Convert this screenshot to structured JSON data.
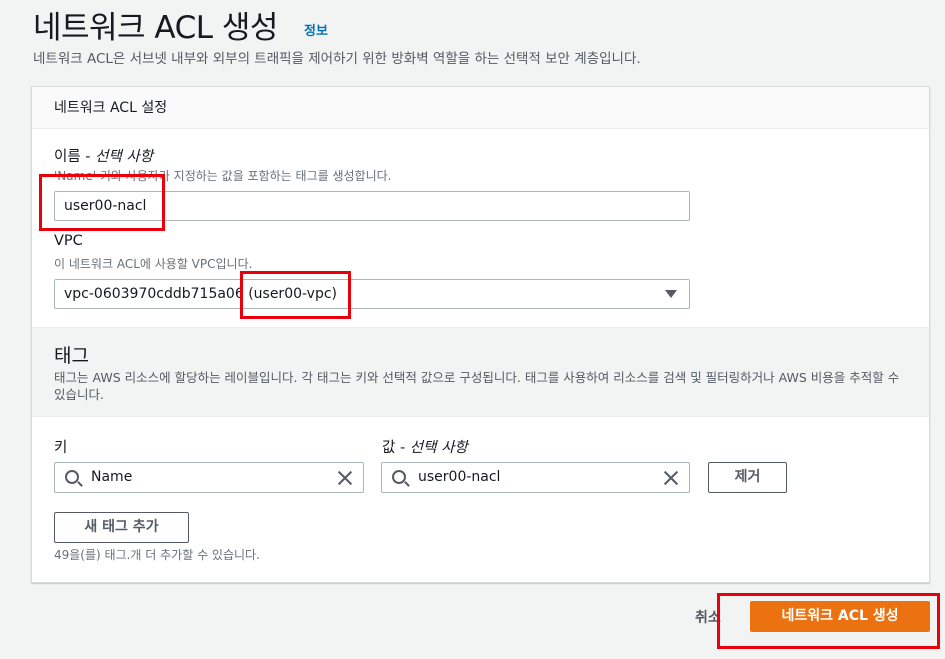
{
  "header": {
    "title": "네트워크 ACL 생성",
    "info_link": "정보",
    "description": "네트워크 ACL은 서브넷 내부와 외부의 트래픽을 제어하기 위한 방화벽 역할을 하는 선택적 보안 계층입니다."
  },
  "settings": {
    "panel_title": "네트워크 ACL 설정",
    "name_label": "이름 - ",
    "name_label_optional": "선택 사항",
    "name_hint": "'Name' 키와 사용자가 지정하는 값을 포함하는 태그를 생성합니다.",
    "name_value": "user00-nacl",
    "vpc_label": "VPC",
    "vpc_hint": "이 네트워크 ACL에 사용할 VPC입니다.",
    "vpc_value": "vpc-0603970cddb715a06 (user00-vpc)"
  },
  "tags": {
    "title": "태그",
    "description": "태그는 AWS 리소스에 할당하는 레이블입니다. 각 태그는 키와 선택적 값으로 구성됩니다. 태그를 사용하여 리소스를 검색 및 필터링하거나 AWS 비용을 추적할 수 있습니다.",
    "key_label": "키",
    "value_label": "값 - ",
    "value_label_optional": "선택 사항",
    "key_value": "Name",
    "value_value": "user00-nacl",
    "remove_button": "제거",
    "add_button": "새 태그 추가",
    "limit_text": "49을(를) 태그.개 더 추가할 수 있습니다."
  },
  "footer": {
    "cancel": "취소",
    "submit": "네트워크 ACL 생성"
  },
  "colors": {
    "primary": "#ec7211",
    "link": "#0073bb",
    "highlight": "#e8000b"
  }
}
